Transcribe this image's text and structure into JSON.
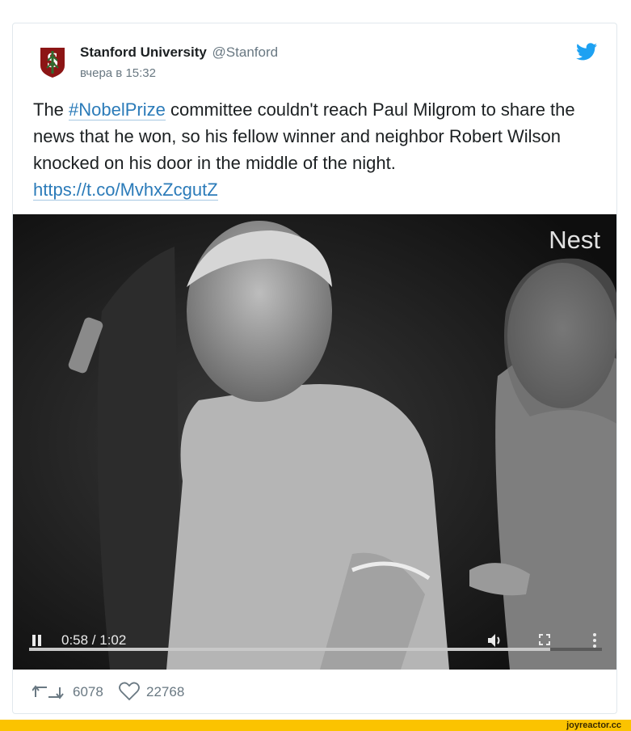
{
  "tweet": {
    "author_name": "Stanford University",
    "author_handle": "@Stanford",
    "timestamp": "вчера в 15:32",
    "text_before": "The ",
    "hashtag": "#NobelPrize",
    "text_after": " committee couldn't reach Paul Milgrom to share the news that he won, so his fellow winner and neighbor Robert Wilson knocked on his door in the middle of the night.",
    "url": "https://t.co/MvhxZcgutZ"
  },
  "video": {
    "watermark": "Nest",
    "timecode": "0:58 / 1:02",
    "progress_fraction": 0.91
  },
  "actions": {
    "retweets": "6078",
    "likes": "22768"
  },
  "footer": {
    "site": "joyreactor.cc"
  },
  "colors": {
    "link": "#2b7bb9",
    "twitter_blue": "#1da1f2",
    "stanford_red": "#8c1515",
    "footer_bar": "#fbc300"
  }
}
